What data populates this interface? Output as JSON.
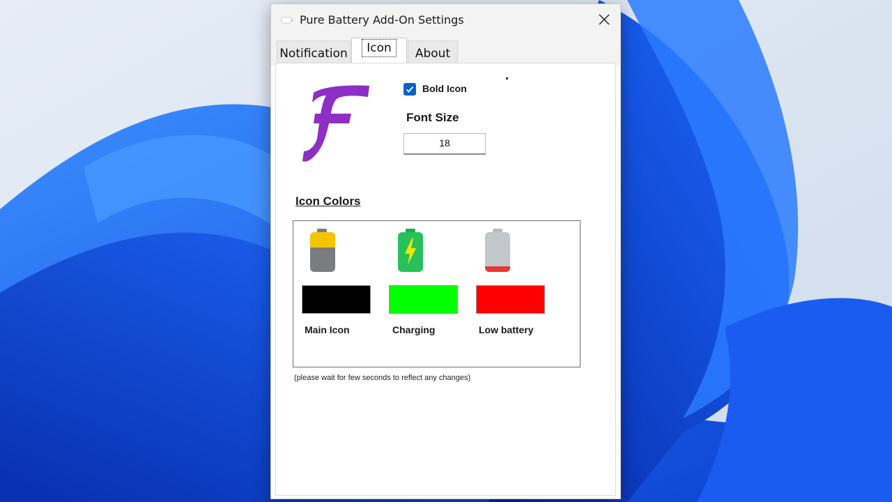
{
  "window": {
    "title": "Pure Battery Add-On Settings"
  },
  "tabs": [
    {
      "label": "Notification",
      "active": false
    },
    {
      "label": "Icon",
      "active": true
    },
    {
      "label": "About",
      "active": false
    }
  ],
  "icon_tab": {
    "preview_icon": "purple-f-letter-icon",
    "preview_color": "#8e2fc4",
    "bold_icon": {
      "label": "Bold Icon",
      "checked": true
    },
    "font_size": {
      "label": "Font Size",
      "value": "18"
    },
    "icon_colors": {
      "heading": "Icon Colors",
      "items": [
        {
          "label": "Main Icon",
          "color": "#000000",
          "icon": "battery-half-yellow-icon"
        },
        {
          "label": "Charging",
          "color": "#00ff00",
          "icon": "battery-charging-green-icon"
        },
        {
          "label": "Low battery",
          "color": "#ff0000",
          "icon": "battery-low-red-icon"
        }
      ]
    },
    "hint": "(please wait for few seconds to reflect any changes)"
  }
}
